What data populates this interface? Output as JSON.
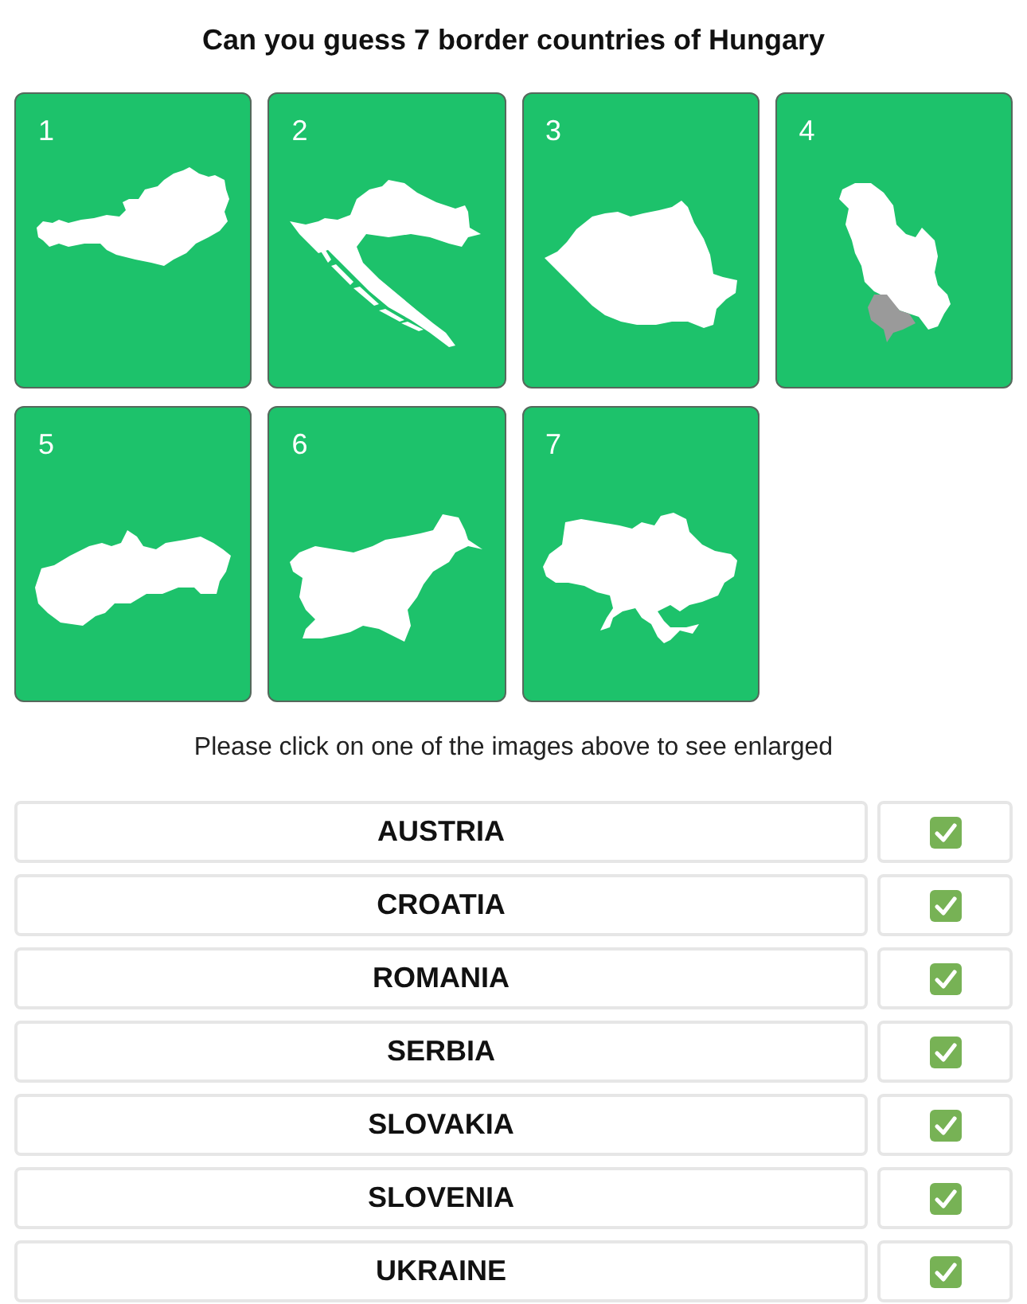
{
  "title": "Can you guess 7 border countries of Hungary",
  "cards": [
    {
      "number": "1"
    },
    {
      "number": "2"
    },
    {
      "number": "3"
    },
    {
      "number": "4"
    },
    {
      "number": "5"
    },
    {
      "number": "6"
    },
    {
      "number": "7"
    }
  ],
  "instruction": "Please click on one of the images above to see enlarged",
  "answers": [
    {
      "text": "AUSTRIA",
      "checked": true
    },
    {
      "text": "CROATIA",
      "checked": true
    },
    {
      "text": "ROMANIA",
      "checked": true
    },
    {
      "text": "SERBIA",
      "checked": true
    },
    {
      "text": "SLOVAKIA",
      "checked": true
    },
    {
      "text": "SLOVENIA",
      "checked": true
    },
    {
      "text": "UKRAINE",
      "checked": true
    }
  ]
}
